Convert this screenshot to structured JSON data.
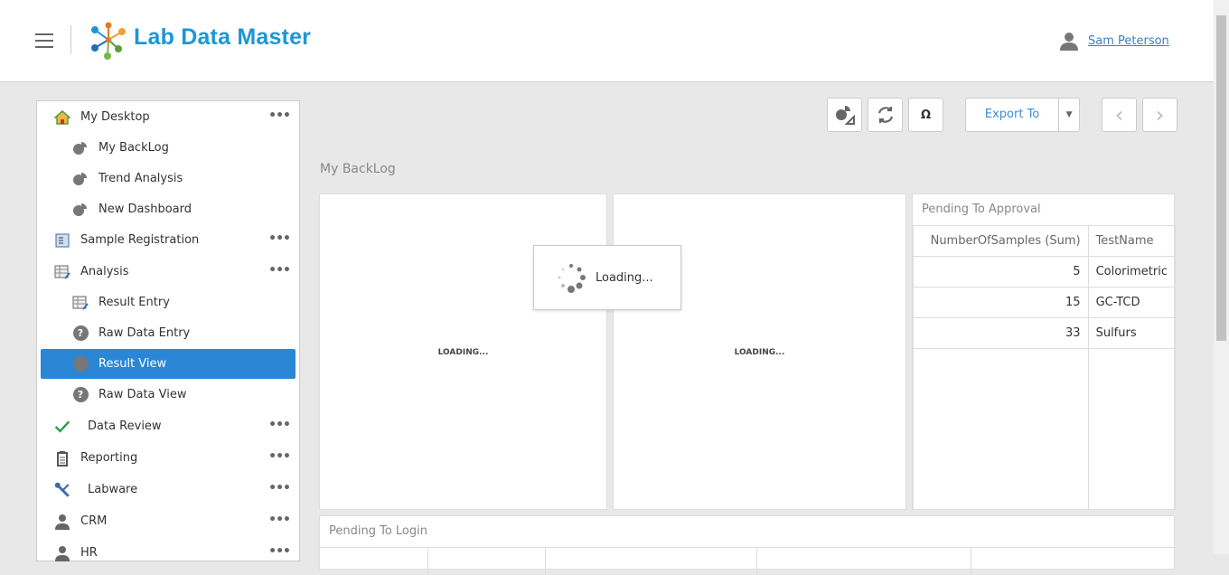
{
  "header": {
    "app_title": "Lab Data Master",
    "user_name": "Sam Peterson"
  },
  "sidebar": {
    "items": [
      {
        "label": "My Desktop",
        "icon": "home-icon",
        "more": "•••"
      },
      {
        "label": "My BackLog",
        "icon": "dashboard-icon"
      },
      {
        "label": "Trend Analysis",
        "icon": "dashboard-icon"
      },
      {
        "label": "New Dashboard",
        "icon": "dashboard-icon"
      },
      {
        "label": "Sample Registration",
        "icon": "registration-icon",
        "more": "•••"
      },
      {
        "label": "Analysis",
        "icon": "analysis-icon",
        "more": "•••"
      },
      {
        "label": "Result Entry",
        "icon": "result-entry-icon"
      },
      {
        "label": "Raw Data Entry",
        "icon": "question-icon"
      },
      {
        "label": "Result View",
        "icon": "question-icon",
        "selected": true
      },
      {
        "label": "Raw Data View",
        "icon": "question-icon"
      },
      {
        "label": "Data Review",
        "icon": "check-icon",
        "more": "•••"
      },
      {
        "label": "Reporting",
        "icon": "clipboard-icon",
        "more": "•••"
      },
      {
        "label": "Labware",
        "icon": "wrench-icon",
        "more": "•••"
      },
      {
        "label": "CRM",
        "icon": "user-icon",
        "more": "•••"
      },
      {
        "label": "HR",
        "icon": "user-icon",
        "more": "•••"
      }
    ]
  },
  "toolbar": {
    "omega": "Ω",
    "export_label": "Export To"
  },
  "main": {
    "section_title": "My BackLog",
    "loading_small": "LOADING...",
    "loading_popup": "Loading...",
    "pending_approval": {
      "title": "Pending To Approval",
      "columns": [
        "NumberOfSamples (Sum)",
        "TestName"
      ],
      "rows": [
        [
          "5",
          "Colorimetric"
        ],
        [
          "15",
          "GC-TCD"
        ],
        [
          "33",
          "Sulfurs"
        ]
      ]
    },
    "pending_login": {
      "title": "Pending To Login"
    }
  },
  "colors": {
    "accent": "#2b87d6",
    "brand": "#1e96d4"
  }
}
